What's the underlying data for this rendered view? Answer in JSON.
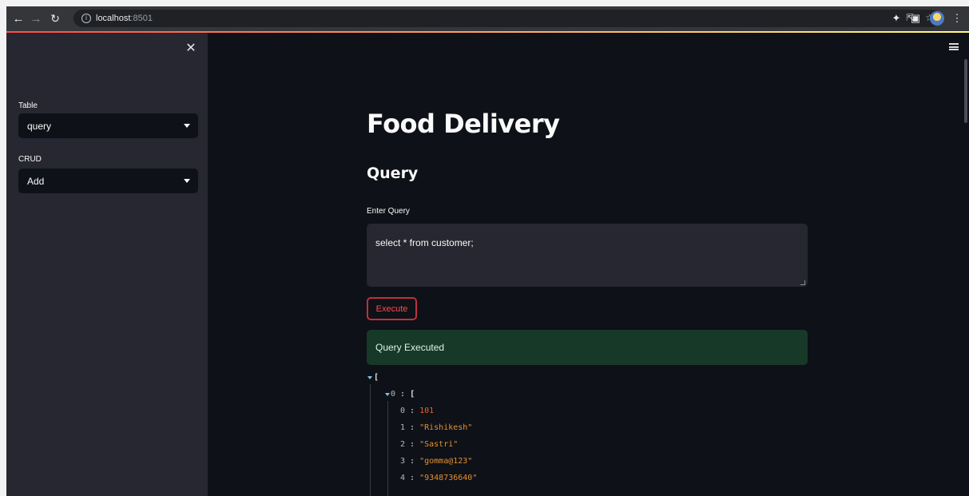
{
  "browser": {
    "url_host": "localhost",
    "url_port": ":8501",
    "back_icon": "arrow-left-icon",
    "forward_icon": "arrow-right-icon",
    "reload_icon": "reload-icon",
    "info_icon": "info-icon",
    "share_icon": "share-icon",
    "bookmark_icon": "star-icon",
    "extensions_icon": "puzzle-icon",
    "sidepanel_icon": "sidepanel-icon",
    "menu_icon": "kebab-icon"
  },
  "sidebar": {
    "close_icon": "close-icon",
    "table_label": "Table",
    "table_value": "query",
    "crud_label": "CRUD",
    "crud_value": "Add"
  },
  "main": {
    "menu_icon": "hamburger-icon",
    "title": "Food Delivery",
    "subtitle": "Query",
    "query_label": "Enter Query",
    "query_value": "select * from customer;",
    "execute_label": "Execute",
    "success_message": "Query Executed"
  },
  "result": {
    "open_bracket": "[",
    "row_key": "0",
    "row": [
      {
        "key": "0",
        "value": "101",
        "type": "number"
      },
      {
        "key": "1",
        "value": "\"Rishikesh\"",
        "type": "string"
      },
      {
        "key": "2",
        "value": "\"Sastri\"",
        "type": "string"
      },
      {
        "key": "3",
        "value": "\"gomma@123\"",
        "type": "string"
      },
      {
        "key": "4",
        "value": "\"9348736640\"",
        "type": "string"
      }
    ]
  },
  "colors": {
    "accent": "#ff4b4b",
    "background": "#0e1117",
    "sidebar": "#262730",
    "success_bg": "#173928"
  }
}
